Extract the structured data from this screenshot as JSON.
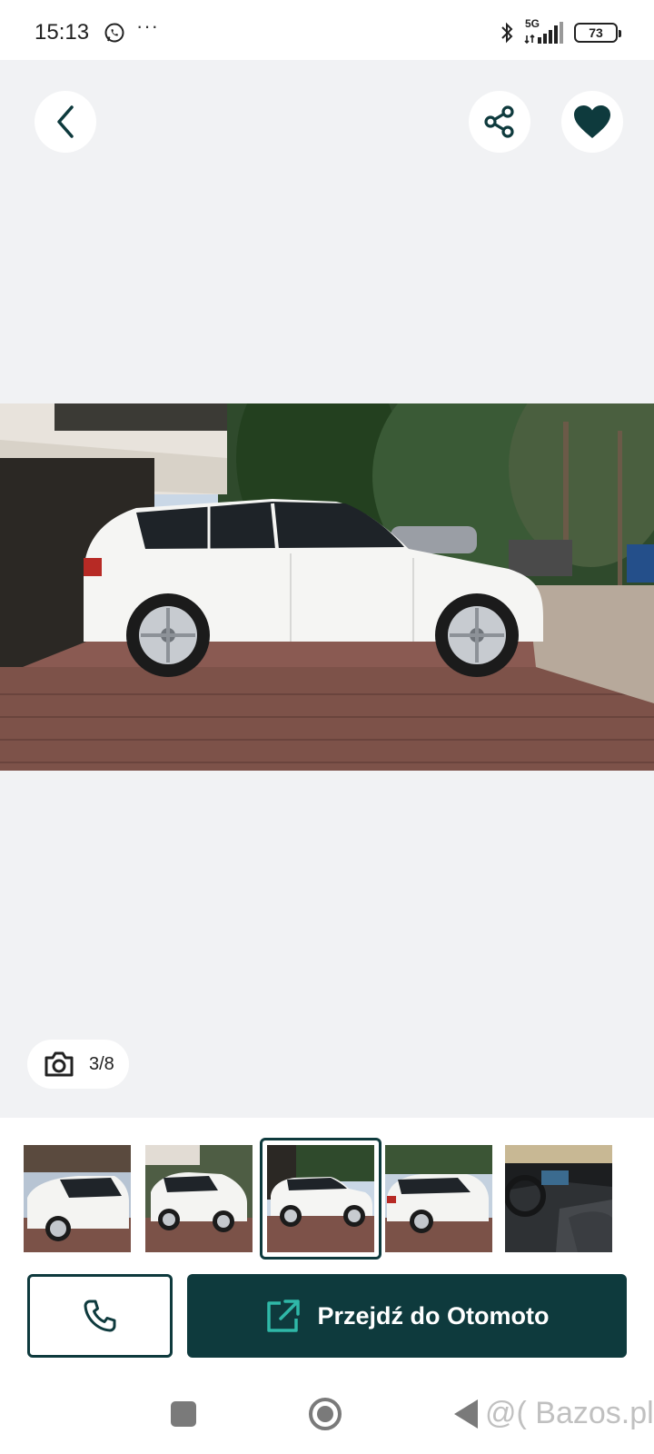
{
  "status_bar": {
    "time": "15:13",
    "more": "···",
    "network": "5G",
    "battery": "73",
    "icons": [
      "whatsapp-icon",
      "bluetooth-icon",
      "signal-icon",
      "battery-icon"
    ]
  },
  "gallery": {
    "counter": "3/8",
    "current_index": 3,
    "total": 8,
    "icons": [
      "back-arrow-icon",
      "share-icon",
      "heart-icon",
      "camera-icon"
    ]
  },
  "thumbnails": [
    {
      "label": "photo-1",
      "active": false
    },
    {
      "label": "photo-2",
      "active": false
    },
    {
      "label": "photo-3",
      "active": true
    },
    {
      "label": "photo-4",
      "active": false
    },
    {
      "label": "photo-5",
      "active": false
    }
  ],
  "actions": {
    "goto_label": "Przejdź do Otomoto",
    "icons": [
      "phone-icon",
      "external-link-icon"
    ]
  },
  "watermark": "@( Bazos.pl",
  "colors": {
    "primary": "#0e3a3d",
    "accent_teal": "#2fb8a8",
    "gallery_bg": "#f1f2f4"
  }
}
